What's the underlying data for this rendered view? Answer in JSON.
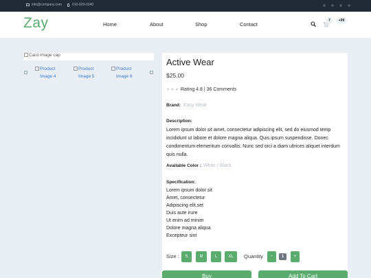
{
  "topbar": {
    "email": "info@company.com",
    "phone": "010-020-0340"
  },
  "header": {
    "brand": "Zay",
    "nav": [
      "Home",
      "About",
      "Shop",
      "Contact"
    ],
    "icons": [
      "search-icon",
      "cart-icon",
      "user-icon"
    ],
    "cart_badge": "7",
    "user_badge": "+99"
  },
  "gallery": {
    "main_image_alt": "Card image cap",
    "thumbnails": [
      "Product Image 4",
      "Product Image 5",
      "Product Image 6"
    ]
  },
  "product": {
    "title": "Active Wear",
    "price": "$25.00",
    "rating_text": "Rating 4.8 | 36 Comments",
    "rating_stars": 5,
    "brand_label": "Brand:",
    "brand_value": "Easy Wear",
    "description_label": "Description:",
    "description": "Lorem ipsum dolor sit amet, consectetur adipiscing elit, sed do eiusmod temp incididunt ut labore et dolore magna aliqua. Quis ipsum suspendisse. Donec condimentum elementum convallis. Nunc sed orci a diam ultrices aliquet interdum quis nulla.",
    "color_label": "Available Color :",
    "color_value": "White / Black",
    "spec_label": "Specification:",
    "specifications": [
      "Lorem ipsum dolor sit",
      "Amet, consectetur",
      "Adipiscing elit,set",
      "Duis aute irure",
      "Ut enim ad minim",
      "Dolore magna aliqua",
      "Excepteur sint"
    ],
    "size_label": "Size :",
    "sizes": [
      "S",
      "M",
      "L",
      "XL"
    ],
    "quantity_label": "Quantity",
    "quantity_minus": "-",
    "quantity_value": "1",
    "quantity_plus": "+",
    "buy_label": "Buy",
    "add_to_cart_label": "Add To Cart"
  },
  "colors": {
    "accent": "#59ab6e",
    "topbar": "#212934",
    "page_bg": "#e9eef5"
  }
}
